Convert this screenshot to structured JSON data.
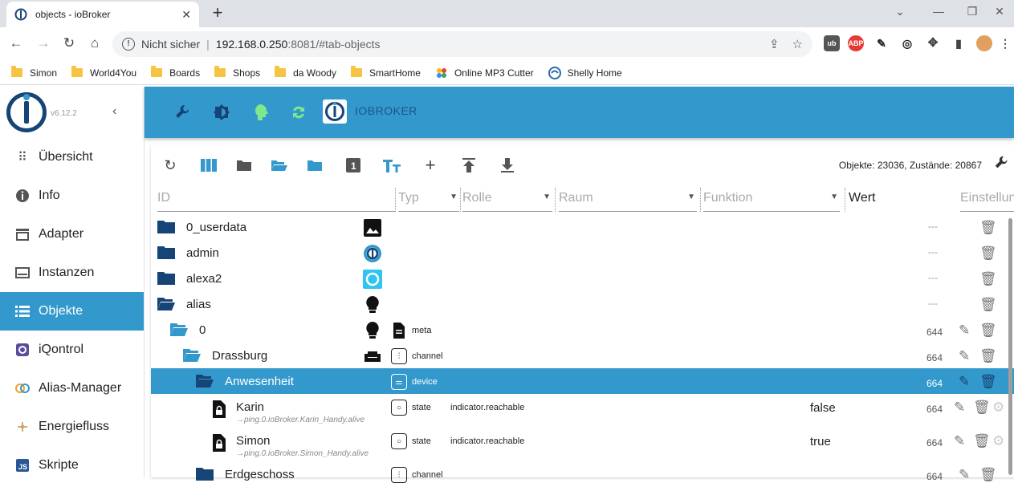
{
  "browser": {
    "tab_title": "objects - ioBroker",
    "address_insecure": "Nicht sicher",
    "address_host": "192.168.0.250",
    "address_path": ":8081/#tab-objects",
    "bookmarks": [
      "Simon",
      "World4You",
      "Boards",
      "Shops",
      "da Woody",
      "SmartHome",
      "Online MP3 Cutter",
      "Shelly Home"
    ]
  },
  "app": {
    "version": "v6.12.2",
    "title": "IOBROKER",
    "accent": "#3399cc",
    "nav": [
      {
        "label": "Übersicht",
        "icon": "grid-icon"
      },
      {
        "label": "Info",
        "icon": "info-icon"
      },
      {
        "label": "Adapter",
        "icon": "store-icon"
      },
      {
        "label": "Instanzen",
        "icon": "instances-icon"
      },
      {
        "label": "Objekte",
        "icon": "list-icon",
        "active": true
      },
      {
        "label": "iQontrol",
        "icon": "iqontrol-icon"
      },
      {
        "label": "Alias-Manager",
        "icon": "alias-icon"
      },
      {
        "label": "Energiefluss",
        "icon": "energy-icon"
      },
      {
        "label": "Skripte",
        "icon": "js-icon"
      }
    ]
  },
  "objects": {
    "counts": "Objekte: 23036, Zustände: 20867",
    "filters": {
      "id": "ID",
      "type": "Typ",
      "role": "Rolle",
      "room": "Raum",
      "function": "Funktion",
      "value": "Wert",
      "settings": "Einstellungen"
    },
    "rows": [
      {
        "name": "0_userdata",
        "level": 0,
        "folder": "closed",
        "acl": "---"
      },
      {
        "name": "admin",
        "level": 0,
        "folder": "closed",
        "acl": "---"
      },
      {
        "name": "alexa2",
        "level": 0,
        "folder": "closed",
        "acl": "---"
      },
      {
        "name": "alias",
        "level": 0,
        "folder": "open",
        "acl": "---"
      },
      {
        "name": "0",
        "level": 1,
        "folder": "open",
        "type": "meta",
        "acl": "644"
      },
      {
        "name": "Drassburg",
        "level": 2,
        "folder": "open",
        "type": "channel",
        "acl": "664"
      },
      {
        "name": "Anwesenheit",
        "level": 3,
        "folder": "open",
        "type": "device",
        "acl": "664",
        "selected": true
      },
      {
        "name": "Karin",
        "level": 4,
        "sub": "→ping.0.ioBroker.Karin_Handy.alive",
        "type": "state",
        "role": "indicator.reachable",
        "value": "false",
        "acl": "664"
      },
      {
        "name": "Simon",
        "level": 4,
        "sub": "→ping.0.ioBroker.Simon_Handy.alive",
        "type": "state",
        "role": "indicator.reachable",
        "value": "true",
        "acl": "664"
      },
      {
        "name": "Erdgeschoss",
        "level": 3,
        "folder": "closed",
        "type": "channel",
        "acl": "664"
      }
    ]
  }
}
